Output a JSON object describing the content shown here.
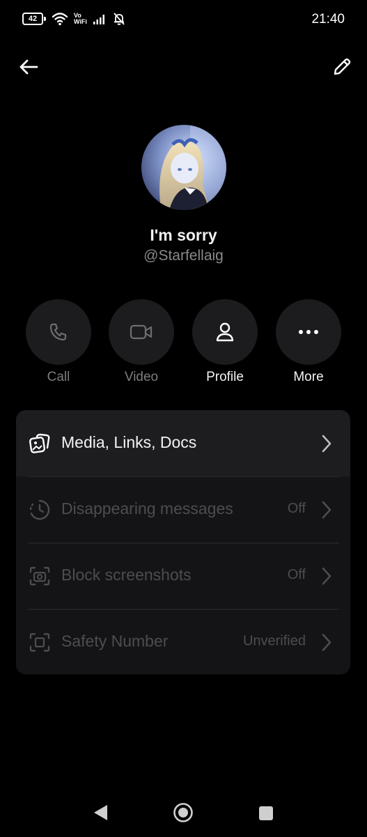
{
  "status_bar": {
    "battery": "42",
    "vowifi_top": "Vo",
    "vowifi_bottom": "WiFi",
    "time": "21:40"
  },
  "header": {
    "back_icon": "arrow-left-icon",
    "edit_icon": "pencil-icon"
  },
  "profile": {
    "display_name": "I'm sorry",
    "handle": "@Starfellaig"
  },
  "actions": [
    {
      "label": "Call",
      "icon": "phone-icon",
      "enabled": false
    },
    {
      "label": "Video",
      "icon": "video-camera-icon",
      "enabled": false
    },
    {
      "label": "Profile",
      "icon": "person-icon",
      "enabled": true
    },
    {
      "label": "More",
      "icon": "more-dots-icon",
      "enabled": true
    }
  ],
  "settings": [
    {
      "label": "Media, Links, Docs",
      "value": "",
      "icon": "media-stack-icon",
      "enabled": true
    },
    {
      "label": "Disappearing messages",
      "value": "Off",
      "icon": "timer-icon",
      "enabled": false
    },
    {
      "label": "Block screenshots",
      "value": "Off",
      "icon": "screenshot-camera-icon",
      "enabled": false
    },
    {
      "label": "Safety Number",
      "value": "Unverified",
      "icon": "safety-number-icon",
      "enabled": false
    }
  ],
  "colors": {
    "background": "#000000",
    "card": "#141416",
    "circle_button": "#1c1c1e",
    "muted_text": "#8a8a8a",
    "disabled_text": "#4d4d50"
  }
}
